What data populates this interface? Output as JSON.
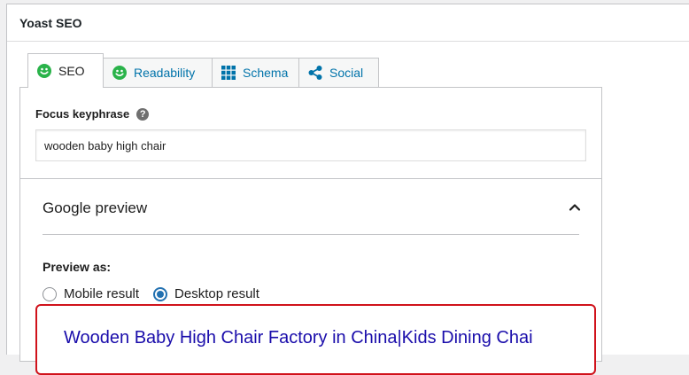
{
  "panel": {
    "title": "Yoast SEO"
  },
  "tabs": [
    {
      "label": "SEO",
      "icon": "smiley-face-icon",
      "active": true
    },
    {
      "label": "Readability",
      "icon": "smiley-face-icon",
      "active": false
    },
    {
      "label": "Schema",
      "icon": "grid-icon",
      "active": false
    },
    {
      "label": "Social",
      "icon": "share-icon",
      "active": false
    }
  ],
  "focus": {
    "label": "Focus keyphrase",
    "value": "wooden baby high chair"
  },
  "google_preview": {
    "title": "Google preview",
    "preview_as_label": "Preview as:",
    "options": [
      "Mobile result",
      "Desktop result"
    ],
    "selected": "Desktop result",
    "serp_title": "Wooden Baby High Chair Factory in China|Kids Dining Chai"
  },
  "colors": {
    "link": "#0073aa",
    "smiley": "#2ab34a",
    "radio_selected": "#2271b1",
    "highlight_border": "#d0121b",
    "serp_title": "#1a0dab"
  }
}
